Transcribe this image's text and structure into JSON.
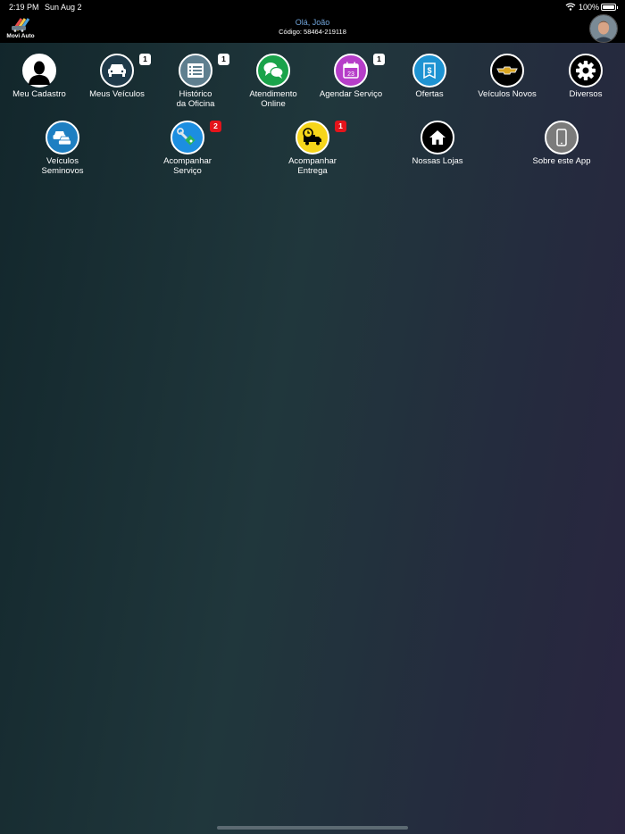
{
  "status_bar": {
    "time": "2:19 PM",
    "date": "Sun Aug 2",
    "battery": "100%"
  },
  "header": {
    "logo_text": "Movi Auto",
    "greeting": "Olá, João",
    "code": "Código: 58464-219118"
  },
  "colors": {
    "greeting_text": "#6fa3d8",
    "badge_red": "#e4141b"
  },
  "menu": [
    {
      "label": "Meu Cadastro",
      "icon": "person-icon",
      "color": "#ffffff",
      "badge": ""
    },
    {
      "label": "Meus Veículos",
      "icon": "car-icon",
      "color": "#1f3a4a",
      "badge": "1"
    },
    {
      "label": "Histórico\nda Oficina",
      "icon": "history-list-icon",
      "color": "#5f7f8f",
      "badge": "1"
    },
    {
      "label": "Atendimento\nOnline",
      "icon": "chat-bubbles-icon",
      "color": "#1aa34a",
      "badge": ""
    },
    {
      "label": "Agendar Serviço",
      "icon": "calendar-icon",
      "color": "#b63ec9",
      "badge": "1"
    },
    {
      "label": "Ofertas",
      "icon": "dollar-tag-icon",
      "color": "#1e93d2",
      "badge": ""
    },
    {
      "label": "Veículos Novos",
      "icon": "chevrolet-logo-icon",
      "color": "#000000",
      "badge": ""
    },
    {
      "label": "Diversos",
      "icon": "gear-icon",
      "color": "#000000",
      "badge": ""
    },
    {
      "label": "Veículos\nSeminovos",
      "icon": "cars-icon",
      "color": "#1e7fc2",
      "badge": ""
    },
    {
      "label": "Acompanhar\nServiço",
      "icon": "wrench-tracking-icon",
      "color": "#1c8ee0",
      "badge": "2"
    },
    {
      "label": "Acompanhar\nEntrega",
      "icon": "delivery-truck-icon",
      "color": "#f6d51a",
      "badge": "1"
    },
    {
      "label": "Nossas Lojas",
      "icon": "house-icon",
      "color": "#000000",
      "badge": ""
    },
    {
      "label": "Sobre este App",
      "icon": "phone-icon",
      "color": "#7b7b7b",
      "badge": ""
    }
  ]
}
